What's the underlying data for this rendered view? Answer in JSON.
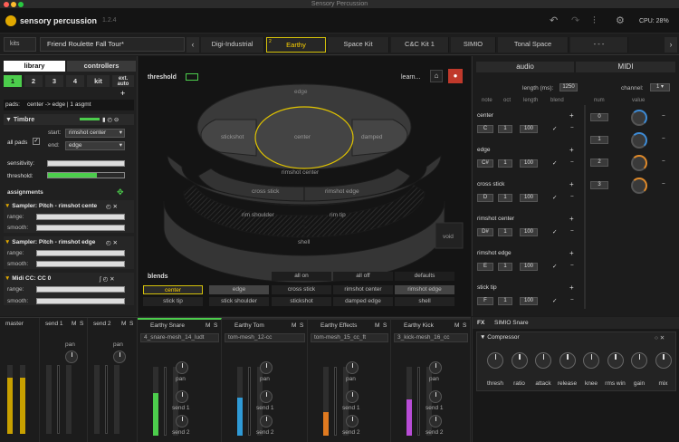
{
  "window": {
    "title": "Sensory Percussion"
  },
  "app": {
    "brand": "sensory percussion",
    "version": "1.2.4",
    "cpu": "CPU: 28%"
  },
  "toolbar": {
    "undo_icon": "undo-icon",
    "redo_icon": "redo-icon",
    "mixer_icon": "sliders-icon",
    "settings_icon": "gear-icon"
  },
  "kit": {
    "kits_label": "kits",
    "current_name": "Friend Roulette Fall Tour*",
    "presets": [
      {
        "num": "",
        "label": "Digi-Industrial"
      },
      {
        "num": "2",
        "label": "Earthy"
      },
      {
        "num": "",
        "label": "Space Kit"
      },
      {
        "num": "",
        "label": "C&C Kit 1"
      },
      {
        "num": "",
        "label": "SIMIO"
      },
      {
        "num": "",
        "label": "Tonal Space"
      },
      {
        "num": "",
        "label": "- - -"
      }
    ]
  },
  "left": {
    "tabs": [
      "library",
      "controllers"
    ],
    "numtabs": [
      "1",
      "2",
      "3",
      "4",
      "kit",
      "ext. auto"
    ],
    "pads_label": "pads:",
    "pads_value": "center -> edge  |  1 asgmt",
    "timbre_header": "Timbre",
    "all_pads": "all pads",
    "start_label": "start:",
    "start_value": "rimshot center",
    "end_label": "end:",
    "end_value": "edge",
    "sensitivity_label": "sensitivity:",
    "threshold_label": "threshold:",
    "assignments_label": "assignments",
    "samplers": [
      {
        "title": "Sampler: Pitch - rimshot cente",
        "range": "range:",
        "smooth": "smooth:"
      },
      {
        "title": "Sampler: Pitch - rimshot edge",
        "range": "range:",
        "smooth": "smooth:"
      },
      {
        "title": "Midi CC: CC 0",
        "range": "range:",
        "smooth": "smooth:"
      }
    ]
  },
  "center": {
    "threshold_label": "threshold",
    "learn_label": "learn...",
    "zones": {
      "edge": "edge",
      "stickshot": "stickshot",
      "center": "center",
      "damped": "damped",
      "rimshot_center": "rimshot center",
      "cross_stick": "cross stick",
      "rimshot_edge": "rimshot edge",
      "rim_shoulder": "rim shoulder",
      "rim_tip": "rim tip",
      "shell": "shell",
      "void": "void"
    },
    "blends_label": "blends",
    "blends_buttons": [
      "all on",
      "all off",
      "defaults"
    ],
    "blends_row1": [
      "center",
      "edge",
      "cross stick",
      "rimshot center",
      "rimshot edge"
    ],
    "blends_row2": [
      "stick tip",
      "stick shoulder",
      "stickshot",
      "damped edge",
      "shell"
    ]
  },
  "right": {
    "tabs": [
      "audio",
      "MIDI"
    ],
    "length_label": "length (ms):",
    "length_value": "1250",
    "channel_label": "channel:",
    "channel_value": "1",
    "columns": [
      "note",
      "oct",
      "length",
      "blend",
      "num",
      "value"
    ],
    "groups": [
      {
        "name": "center",
        "note": "C",
        "oct": "1",
        "len": "100"
      },
      {
        "name": "edge",
        "note": "C#",
        "oct": "1",
        "len": "100"
      },
      {
        "name": "cross stick",
        "note": "D",
        "oct": "1",
        "len": "100"
      },
      {
        "name": "rimshot center",
        "note": "D#",
        "oct": "1",
        "len": "100"
      },
      {
        "name": "rimshot edge",
        "note": "E",
        "oct": "1",
        "len": "100"
      },
      {
        "name": "stick tip",
        "note": "F",
        "oct": "1",
        "len": "100"
      }
    ],
    "cc": [
      {
        "num": "0",
        "color": "#3d8bd6"
      },
      {
        "num": "1",
        "color": "#3d8bd6"
      },
      {
        "num": "2",
        "color": "#e08a2a"
      },
      {
        "num": "3",
        "color": "#e08a2a"
      }
    ]
  },
  "mixer": {
    "strips": [
      {
        "name": "master",
        "m": "",
        "s": "",
        "color": "#c8a000",
        "meter": 0.82
      },
      {
        "name": "send 1",
        "m": "M",
        "s": "S",
        "color": "#7a7a7a",
        "meter": 0.0
      },
      {
        "name": "send 2",
        "m": "M",
        "s": "S",
        "color": "#7a7a7a",
        "meter": 0.0
      },
      {
        "name": "Earthy Snare",
        "m": "M",
        "s": "S",
        "color": "#4ccd4c",
        "meter": 0.62,
        "device": "4_snare-mesh_14_ludt"
      },
      {
        "name": "Earthy Tom",
        "m": "M",
        "s": "S",
        "color": "#2f9ad6",
        "meter": 0.55,
        "device": "tom-mesh_12-cc"
      },
      {
        "name": "Earthy Effects",
        "m": "M",
        "s": "S",
        "color": "#e07a20",
        "meter": 0.34,
        "device": "tom-mesh_15_cc_ft"
      },
      {
        "name": "Earthy Kick",
        "m": "M",
        "s": "S",
        "color": "#b84cd6",
        "meter": 0.52,
        "device": "3_kick-mesh_16_cc"
      }
    ],
    "pan_label": "pan",
    "send1_label": "send 1",
    "send2_label": "send 2"
  },
  "fx": {
    "header": "SIMIO Snare",
    "fx_label": "FX",
    "device": "Compressor",
    "knobs": [
      "thresh",
      "ratio",
      "attack",
      "release",
      "knee",
      "rms win",
      "gain",
      "mix"
    ]
  }
}
